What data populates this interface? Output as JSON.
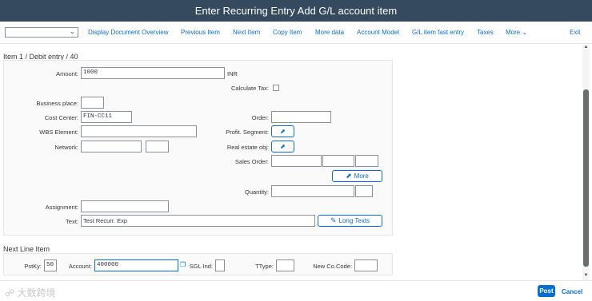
{
  "window": {
    "title": "Enter Recurring Entry Add G/L account item"
  },
  "toolbar": {
    "select_value": "",
    "display_document_overview": "Display Document Overview",
    "previous_item": "Previous Item",
    "next_item": "Next Item",
    "copy_item": "Copy Item",
    "more_data": "More data",
    "account_model": "Account Model",
    "gl_item_fast_entry": "G/L item fast entry",
    "taxes": "Taxes",
    "more": "More",
    "exit": "Exit"
  },
  "item": {
    "header": "Item 1 / Debit entry / 40",
    "amount_label": "Amount:",
    "amount_value": "1000",
    "currency": "INR",
    "calculate_tax_label": "Calculate Tax:",
    "business_place_label": "Business place:",
    "business_place_value": "",
    "cost_center_label": "Cost Center:",
    "cost_center_value": "FIN-CC11",
    "order_label": "Order:",
    "order_value": "",
    "wbs_element_label": "WBS Element:",
    "wbs_element_value": "",
    "profit_segment_label": "Profit. Segment:",
    "network_label": "Network:",
    "network_value": "",
    "network_value2": "",
    "real_estate_label": "Real estate obj:",
    "sales_order_label": "Sales Order:",
    "sales_order_value": "",
    "more_button": "More",
    "quantity_label": "Quantity:",
    "quantity_value": "",
    "assignment_label": "Assignment:",
    "assignment_value": "",
    "text_label": "Text:",
    "text_value": "Test Recurr. Exp",
    "long_texts_button": "Long Texts"
  },
  "next_line": {
    "header": "Next Line Item",
    "pstky_label": "PstKy:",
    "pstky_value": "50",
    "account_label": "Account:",
    "account_value": "400000",
    "sgl_ind_label": "SGL Ind:",
    "sgl_ind_value": "",
    "ttype_label": "TType:",
    "ttype_value": "",
    "new_cocode_label": "New Co.Code:",
    "new_cocode_value": ""
  },
  "footer": {
    "logo_text": "大数跨境",
    "post": "Post",
    "cancel": "Cancel"
  },
  "colors": {
    "titlebar": "#354a5f",
    "accent": "#0a6ed1"
  },
  "icons": [
    "chevron-down-icon",
    "navigate-icon",
    "value-help-icon",
    "long-text-icon",
    "scroll-up-icon",
    "scroll-down-icon",
    "logo-icon"
  ]
}
